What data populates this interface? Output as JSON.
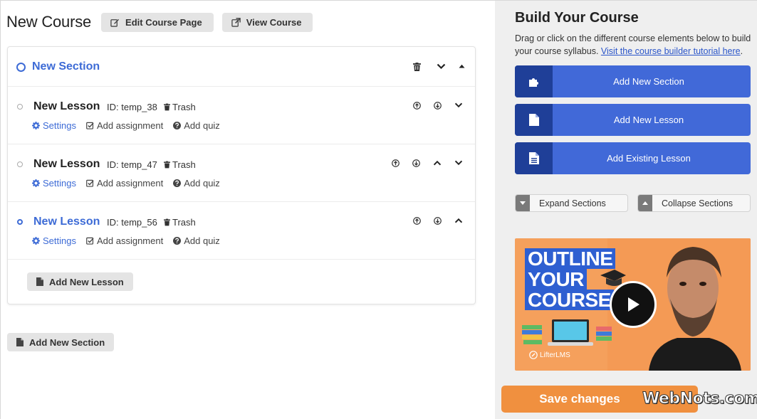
{
  "header": {
    "title": "New Course",
    "edit_course_page_label": "Edit Course Page",
    "view_course_label": "View Course"
  },
  "section": {
    "title": "New Section"
  },
  "lessons": [
    {
      "title": "New Lesson",
      "id": "ID: temp_38",
      "trash": "Trash",
      "settings": "Settings",
      "add_assignment": "Add assignment",
      "add_quiz": "Add quiz",
      "active": false
    },
    {
      "title": "New Lesson",
      "id": "ID: temp_47",
      "trash": "Trash",
      "settings": "Settings",
      "add_assignment": "Add assignment",
      "add_quiz": "Add quiz",
      "active": false
    },
    {
      "title": "New Lesson",
      "id": "ID: temp_56",
      "trash": "Trash",
      "settings": "Settings",
      "add_assignment": "Add assignment",
      "add_quiz": "Add quiz",
      "active": true
    }
  ],
  "add_new_lesson_label": "Add New Lesson",
  "add_new_section_label": "Add New Section",
  "panel": {
    "title": "Build Your Course",
    "description": "Drag or click on the different course elements below to build your course syllabus.",
    "tutorial_link": "Visit the course builder tutorial here",
    "tutorial_suffix": ".",
    "add_new_section": "Add New Section",
    "add_new_lesson": "Add New Lesson",
    "add_existing_lesson": "Add Existing Lesson",
    "expand_sections": "Expand Sections",
    "collapse_sections": "Collapse Sections"
  },
  "video": {
    "line1": "OUTLINE",
    "line2": "YOUR",
    "line3": "COURSE",
    "brand": "LifterLMS"
  },
  "save_changes_label": "Save changes",
  "watermark": "WebNots.com",
  "colors": {
    "accent_blue": "#3d6bd6",
    "button_blue": "#4169d8",
    "button_icon_blue": "#1f3f98",
    "save_orange": "#f0903f"
  }
}
